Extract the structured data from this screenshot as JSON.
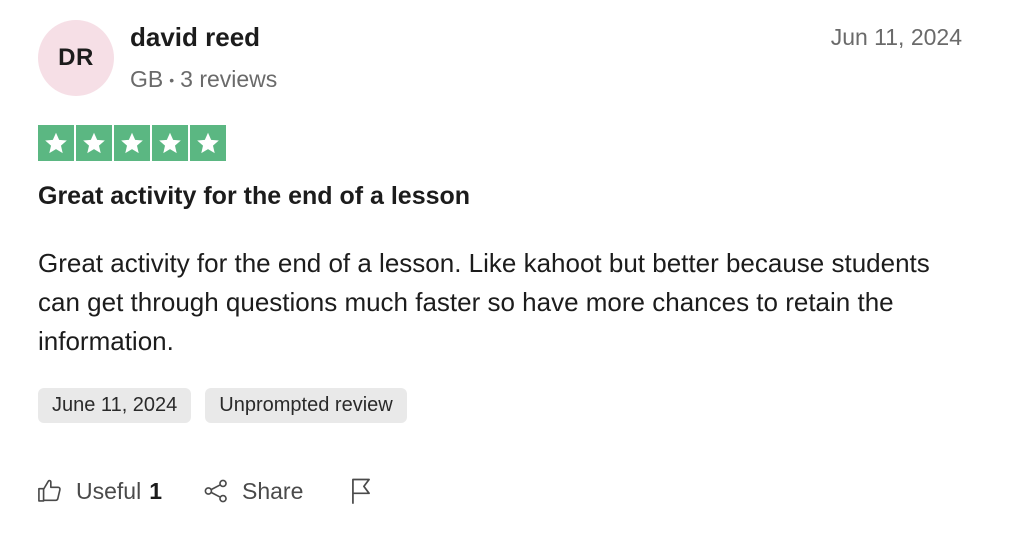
{
  "reviewer": {
    "initials": "DR",
    "name": "david reed",
    "country": "GB",
    "separator": "•",
    "review_count": "3 reviews"
  },
  "review": {
    "date_label": "Jun 11, 2024",
    "rating": 5,
    "rating_max": 5,
    "star_color": "#5bb782",
    "title": "Great activity for the end of a lesson",
    "body": "Great activity for the end of a lesson. Like kahoot but better because students can get through questions much faster so have more chances to retain the information."
  },
  "tags": [
    {
      "label": "June 11, 2024"
    },
    {
      "label": "Unprompted review"
    }
  ],
  "actions": {
    "useful_label": "Useful",
    "useful_count": "1",
    "share_label": "Share",
    "useful_icon": "thumbs-up-icon",
    "share_icon": "share-icon",
    "report_icon": "flag-icon"
  },
  "colors": {
    "avatar_bg": "#f6dfe6",
    "tag_bg": "#e9e9e9"
  }
}
